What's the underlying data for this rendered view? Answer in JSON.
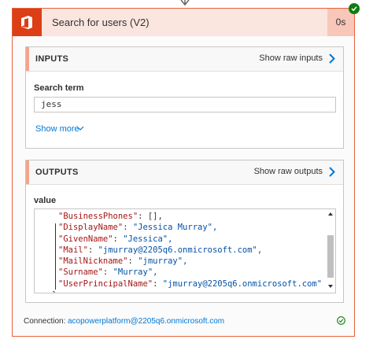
{
  "action": {
    "title": "Search for users (V2)",
    "duration": "0s",
    "status": "succeeded",
    "icon": "office-icon",
    "accent_color": "#dc3e15"
  },
  "inputs": {
    "header": "INPUTS",
    "raw_link": "Show raw inputs",
    "field_label": "Search term",
    "field_value": "jess",
    "show_more": "Show more"
  },
  "outputs": {
    "header": "OUTPUTS",
    "raw_link": "Show raw outputs",
    "field_label": "value",
    "code": [
      {
        "key": "\"BusinessPhones\"",
        "sep": ": ",
        "val": "[],",
        "val_is_string": false
      },
      {
        "key": "\"DisplayName\"",
        "sep": ": ",
        "val": "\"Jessica Murray\",",
        "val_is_string": true
      },
      {
        "key": "\"GivenName\"",
        "sep": ": ",
        "val": "\"Jessica\",",
        "val_is_string": true
      },
      {
        "key": "\"Mail\"",
        "sep": ": ",
        "val": "\"jmurray@2205q6.onmicrosoft.com\",",
        "val_is_string": true
      },
      {
        "key": "\"MailNickname\"",
        "sep": ": ",
        "val": "\"jmurray\",",
        "val_is_string": true
      },
      {
        "key": "\"Surname\"",
        "sep": ": ",
        "val": "\"Murray\",",
        "val_is_string": true
      },
      {
        "key": "\"UserPrincipalName\"",
        "sep": ": ",
        "val": "\"jmurray@2205q6.onmicrosoft.com\"",
        "val_is_string": true
      },
      {
        "key": "}",
        "sep": "",
        "val": "",
        "val_is_string": false
      }
    ]
  },
  "connection": {
    "label": "Connection:",
    "value": "acopowerplatform@2205q6.onmicrosoft.com",
    "status_icon": "check-circle-icon"
  }
}
